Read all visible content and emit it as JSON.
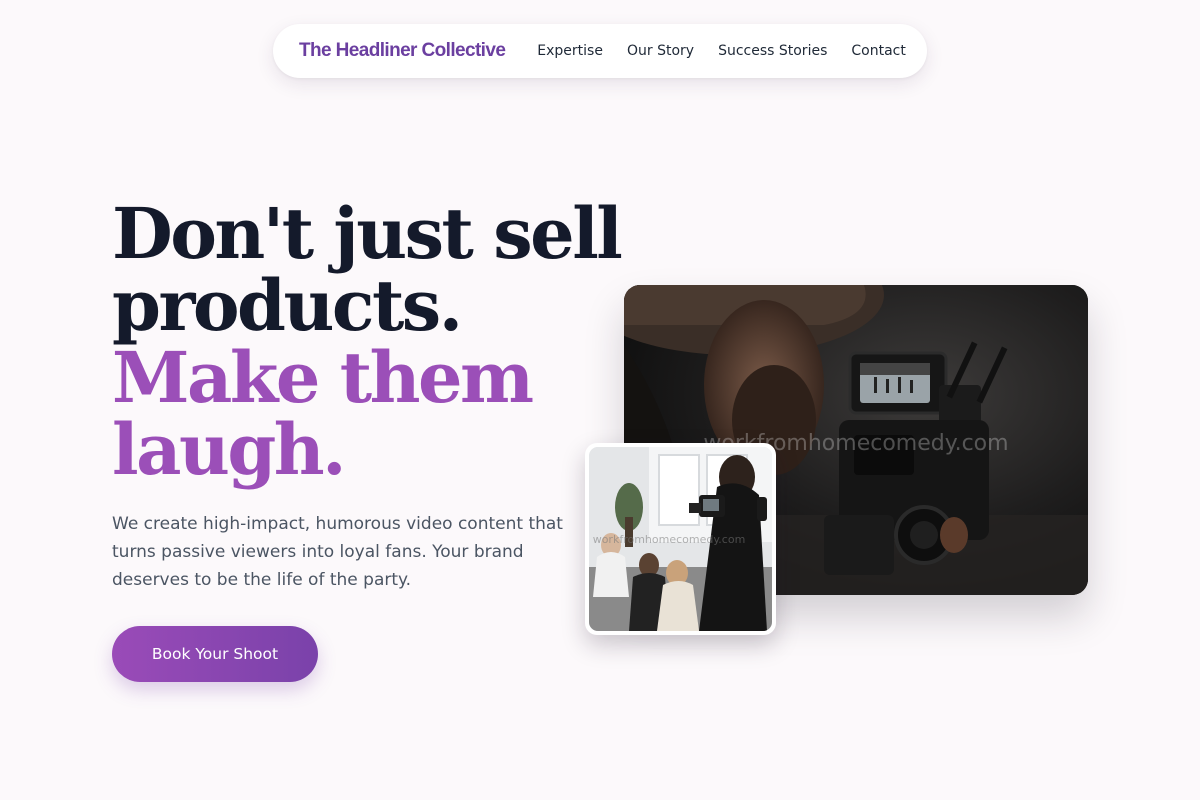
{
  "nav": {
    "brand": "The Headliner Collective",
    "links": [
      "Expertise",
      "Our Story",
      "Success Stories",
      "Contact"
    ]
  },
  "hero": {
    "headline_dark": [
      "Don't just sell",
      "products."
    ],
    "headline_accent": [
      "Make them",
      "laugh."
    ],
    "subtext": "We create high-impact, humorous video content that turns passive viewers into loyal fans. Your brand deserves to be the life of the party.",
    "cta_label": "Book Your Shoot"
  },
  "images": {
    "main_watermark": "workfromhomecomedy.com",
    "inset_watermark": "workfromhomecomedy.com"
  },
  "colors": {
    "brand": "#6b3fa0",
    "accent": "#9b4fb8",
    "headline": "#141a2b",
    "cta_start": "#9a4bb8",
    "cta_end": "#7a42aa",
    "background": "#fcf9fb"
  }
}
